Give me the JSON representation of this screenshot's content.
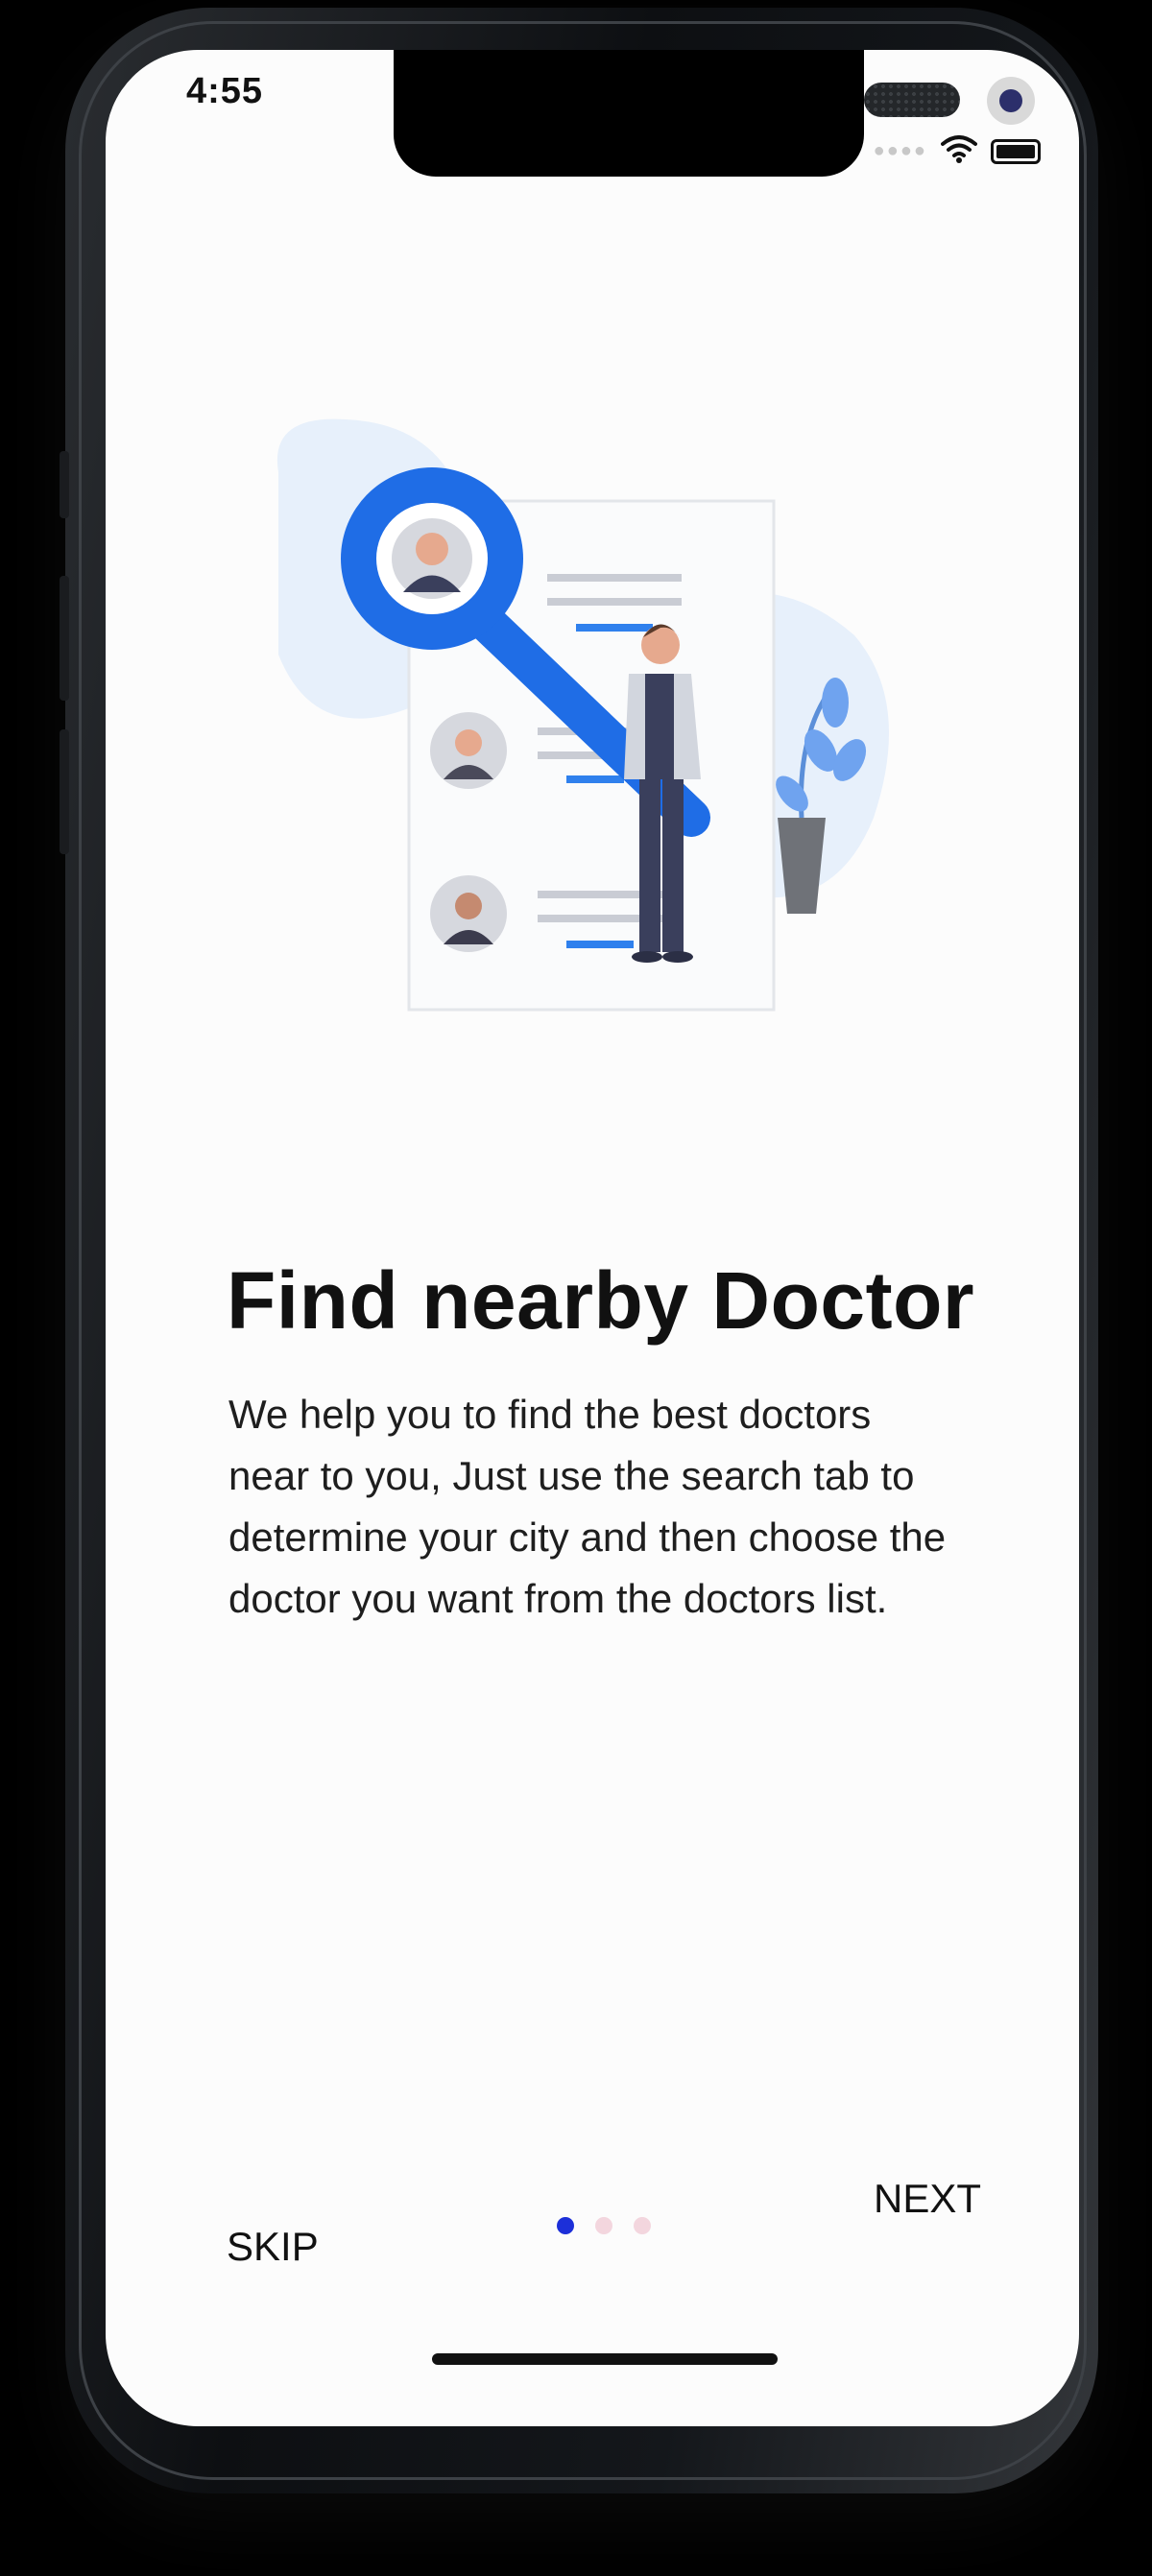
{
  "status_bar": {
    "time": "4:55",
    "icons": [
      "signal-icon",
      "wifi-icon",
      "battery-icon"
    ]
  },
  "onboarding": {
    "illustration": "doctor-search-illustration",
    "title": "Find nearby Doctor",
    "description": "We help you to find the best doctors near to you, Just use the search tab to determine your city and then choose the doctor you want from the doctors list.",
    "page_indicator": {
      "total": 3,
      "current": 1
    }
  },
  "footer": {
    "skip_label": "SKIP",
    "next_label": "NEXT"
  },
  "colors": {
    "accent": "#1f6de6",
    "active_dot": "#1c2fd9",
    "inactive_dot": "#f3d6de",
    "screen_bg": "#fcfcfc",
    "text": "#111111"
  }
}
